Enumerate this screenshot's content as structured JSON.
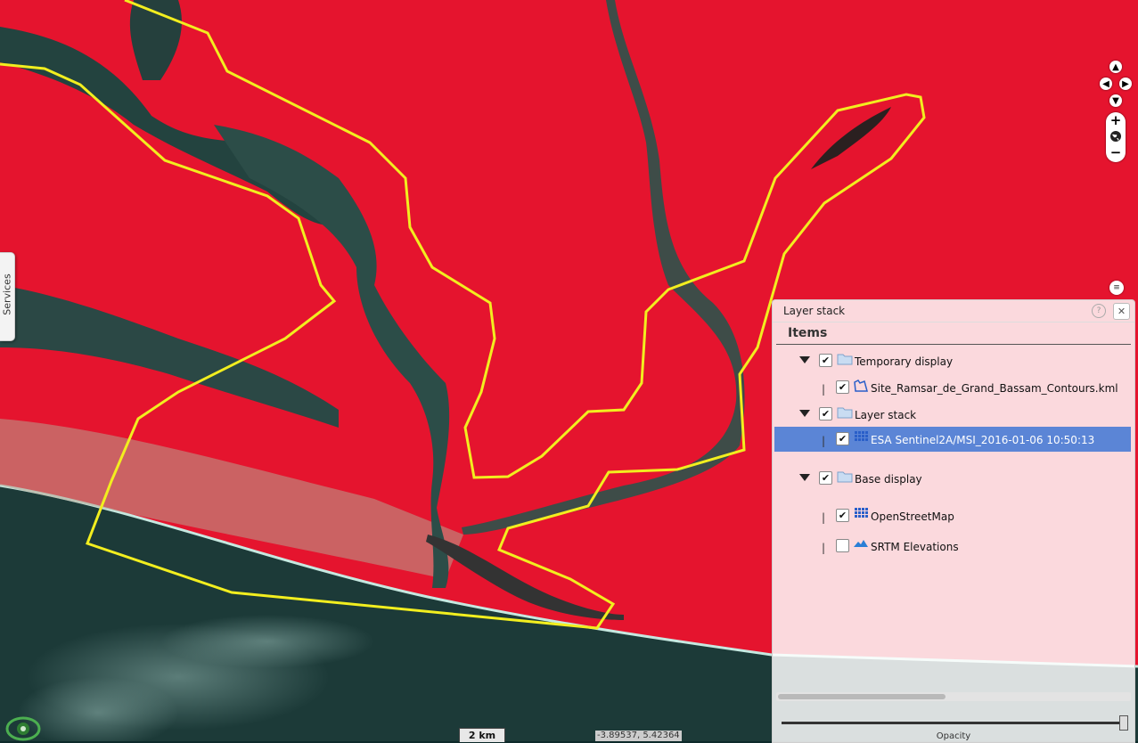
{
  "services_tab": {
    "label": "Services"
  },
  "map": {
    "scale_label": "2 km",
    "coordinates": "-3.89537, 5.42364",
    "colors": {
      "vegetation": "#e8102c",
      "water": "#2a3d3a",
      "ocean": "#1e3b3a",
      "boundary": "#f2ee1f"
    }
  },
  "layer_panel": {
    "title": "Layer stack",
    "items_header": "Items",
    "groups": [
      {
        "label": "Temporary display",
        "children": [
          {
            "label": "Site_Ramsar_de_Grand_Bassam_Contours.kml",
            "icon": "polygon-icon"
          }
        ]
      },
      {
        "label": "Layer stack",
        "children": [
          {
            "label": "ESA Sentinel2A/MSI_2016-01-06 10:50:13",
            "icon": "raster-grid-icon"
          }
        ]
      },
      {
        "label": "Base display",
        "children": [
          {
            "label": "OpenStreetMap",
            "icon": "raster-grid-icon"
          },
          {
            "label": "SRTM Elevations",
            "icon": "elevation-icon"
          }
        ]
      }
    ],
    "opacity_label": "Opacity",
    "opacity_value": 1.0
  }
}
